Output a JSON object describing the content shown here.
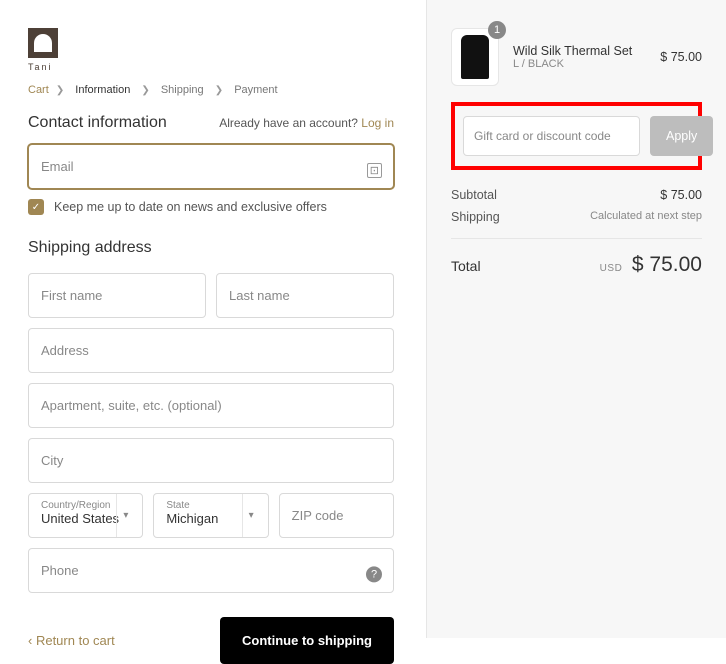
{
  "logo_text": "Tani",
  "breadcrumb": {
    "cart": "Cart",
    "information": "Information",
    "shipping": "Shipping",
    "payment": "Payment"
  },
  "contact": {
    "title": "Contact information",
    "prompt": "Already have an account?",
    "login": "Log in",
    "email_placeholder": "Email",
    "newsletter": "Keep me up to date on news and exclusive offers"
  },
  "shipping": {
    "title": "Shipping address",
    "first_name": "First name",
    "last_name": "Last name",
    "address": "Address",
    "apartment": "Apartment, suite, etc. (optional)",
    "city": "City",
    "country_label": "Country/Region",
    "country_value": "United States",
    "state_label": "State",
    "state_value": "Michigan",
    "zip": "ZIP code",
    "phone": "Phone"
  },
  "footer": {
    "return": "Return to cart",
    "continue": "Continue to shipping"
  },
  "order": {
    "product": {
      "name": "Wild Silk Thermal Set",
      "variant": "L / BLACK",
      "qty": "1",
      "price": "$ 75.00"
    },
    "discount_placeholder": "Gift card or discount code",
    "apply": "Apply",
    "subtotal_label": "Subtotal",
    "subtotal_value": "$ 75.00",
    "shipping_label": "Shipping",
    "shipping_value": "Calculated at next step",
    "total_label": "Total",
    "total_currency": "USD",
    "total_value": "$ 75.00"
  }
}
